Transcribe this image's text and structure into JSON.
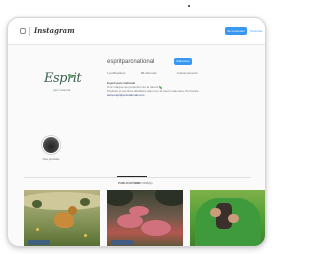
{
  "app": {
    "brand": "Instagram"
  },
  "header": {
    "login_label": "Se connecter",
    "signup_label": "S'inscrire"
  },
  "profile": {
    "username": "espritparcnational",
    "follow_label": "S'abonner",
    "stats": {
      "posts": "1 publications",
      "followers": "89 abonnés",
      "following": "0 abonnements"
    },
    "bio": {
      "name": "Esprit parc national",
      "line1": "Une marque de protection de la nature",
      "line2": "Produits et services labellisés dans les 11 parcs nationaux de France",
      "link": "www.espritparcnational.com"
    },
    "logo": {
      "script": "Esprit",
      "subtitle": "parc national"
    }
  },
  "highlights": [
    {
      "label": "Nos produits"
    }
  ],
  "tabs": {
    "posts_label": "PUBLICATIONS",
    "tagged_label": "IDENTIFIÉ(E)"
  },
  "colors": {
    "accent": "#3897f0",
    "logo_green": "#3e5d52",
    "leaf_green": "#4aa44f"
  },
  "icons": {
    "brand_icon": "instagram-camera-icon",
    "leaf_icon": "leaf-icon"
  }
}
